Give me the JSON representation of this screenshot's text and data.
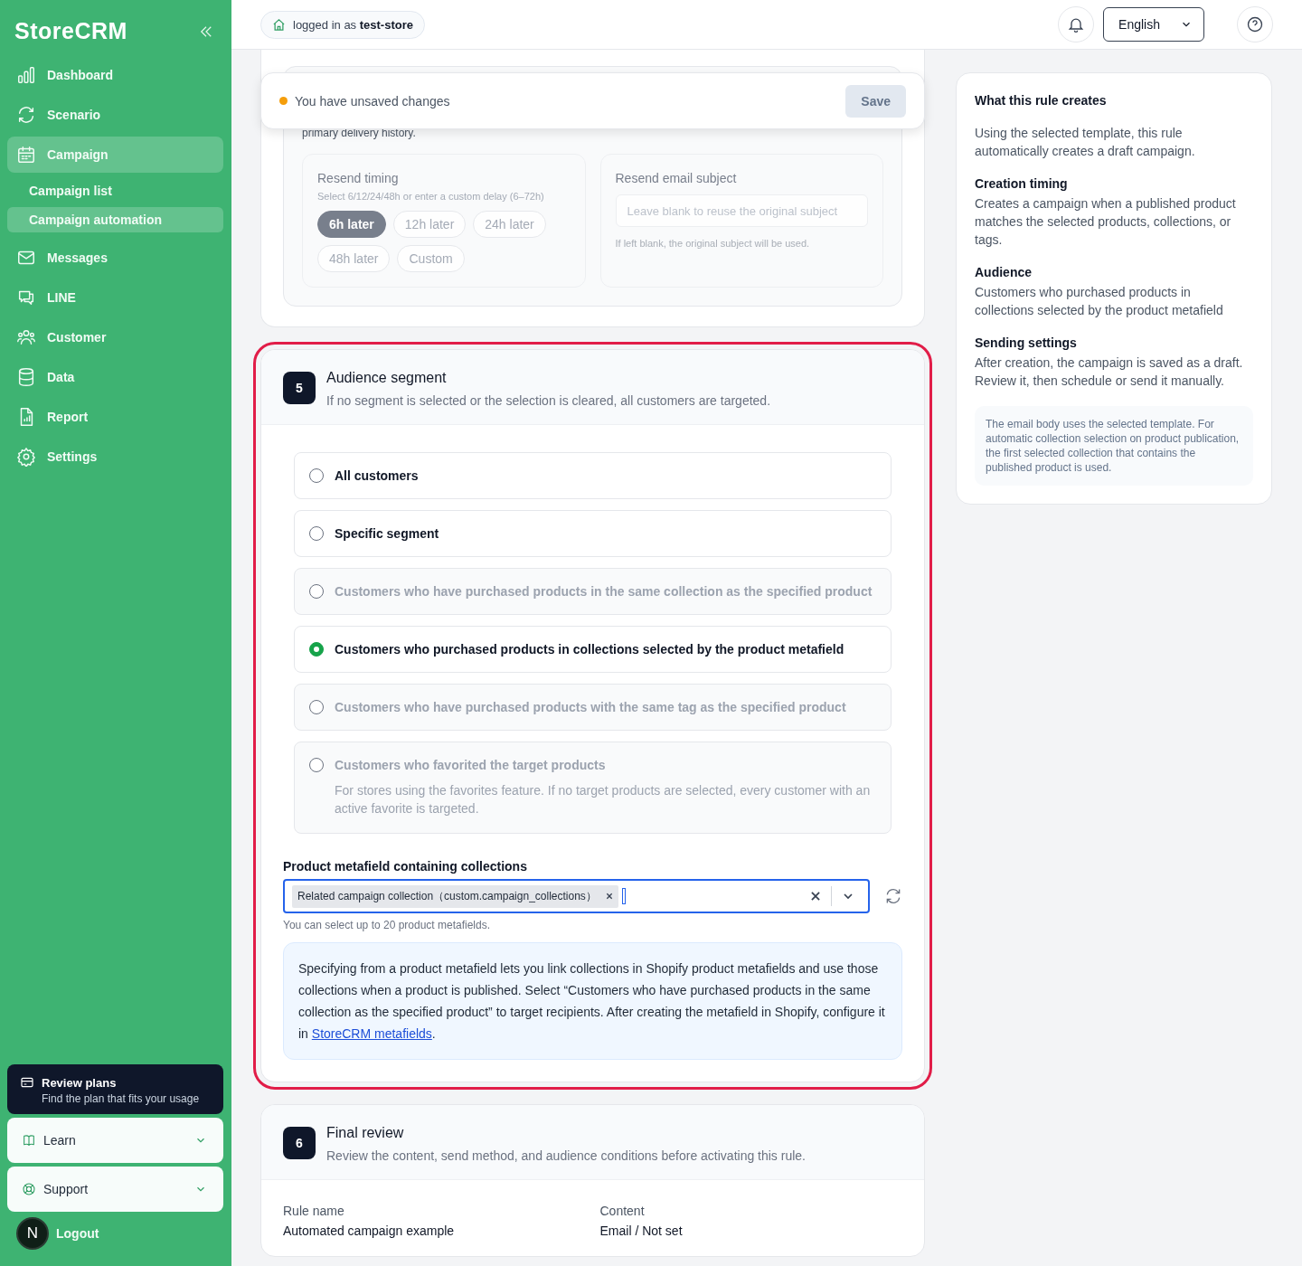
{
  "sidebar": {
    "brand": "StoreCRM",
    "items": [
      {
        "label": "Dashboard",
        "selected": false
      },
      {
        "label": "Scenario",
        "selected": false
      },
      {
        "label": "Campaign",
        "selected": true,
        "children": [
          {
            "label": "Campaign list",
            "selected": false
          },
          {
            "label": "Campaign automation",
            "selected": true
          }
        ]
      },
      {
        "label": "Messages",
        "selected": false
      },
      {
        "label": "LINE",
        "selected": false
      },
      {
        "label": "Customer",
        "selected": false
      },
      {
        "label": "Data",
        "selected": false
      },
      {
        "label": "Report",
        "selected": false
      },
      {
        "label": "Settings",
        "selected": false
      }
    ],
    "plans": {
      "title": "Review plans",
      "subtitle": "Find the plan that fits your usage"
    },
    "expanders": [
      {
        "label": "Learn",
        "expanded": false
      },
      {
        "label": "Support",
        "expanded": false
      }
    ],
    "logout": "Logout",
    "avatar": "N"
  },
  "topbar": {
    "login": "logged in as **test-store**",
    "language": "English"
  },
  "unsaved": {
    "message": "You have unsaved changes",
    "save": "Save"
  },
  "previous_section": {
    "text_tail": "primary delivery history.",
    "resend_timing": {
      "label": "Resend timing",
      "hint": "Select 6/12/24/48h or enter a custom delay (6–72h)",
      "options": [
        {
          "label": "6h later",
          "selected": true
        },
        {
          "label": "12h later",
          "selected": false
        },
        {
          "label": "24h later",
          "selected": false
        },
        {
          "label": "48h later",
          "selected": false
        },
        {
          "label": "Custom",
          "selected": false
        }
      ]
    },
    "resend_subject": {
      "label": "Resend email subject",
      "placeholder": "Leave blank to reuse the original subject",
      "help": "If left blank, the original subject will be used."
    }
  },
  "audience": {
    "step": "5",
    "title": "Audience segment",
    "description": "If no segment is selected or the selection is cleared, all customers are targeted.",
    "highlighted": true,
    "options": [
      {
        "label": "All customers",
        "selected": false,
        "disabled": false
      },
      {
        "label": "Specific segment",
        "selected": false,
        "disabled": false
      },
      {
        "label": "Customers who have purchased products in the same collection as the specified product",
        "selected": false,
        "disabled": true
      },
      {
        "label": "Customers who purchased products in collections selected by the product metafield",
        "selected": true,
        "disabled": false
      },
      {
        "label": "Customers who have purchased products with the same tag as the specified product",
        "selected": false,
        "disabled": true
      },
      {
        "label": "Customers who favorited the target products",
        "description": "For stores using the favorites feature. If no target products are selected, every customer with an active favorite is targeted.",
        "selected": false,
        "disabled": true
      }
    ],
    "metafield": {
      "label": "Product metafield containing collections",
      "tags": [
        "Related campaign collection（custom.campaign_collections）"
      ],
      "help": "You can select up to 20 product metafields."
    },
    "info": {
      "text": "Specifying from a product metafield lets you link collections in Shopify product metafields and use those collections when a product is published. Select “Customers who have purchased products in the same collection as the specified product” to target recipients. After creating the metafield in Shopify, configure it in ",
      "link": "StoreCRM metafields",
      "end": "."
    }
  },
  "review": {
    "step": "6",
    "title": "Final review",
    "description": "Review the content, send method, and audience conditions before activating this rule.",
    "fields": [
      {
        "label": "Rule name",
        "value": "Automated campaign example"
      },
      {
        "label": "Content",
        "value": "Email / Not set"
      }
    ]
  },
  "summary": {
    "title": "What this rule creates",
    "intro": "Using the selected template, this rule automatically creates a draft campaign.",
    "items": [
      {
        "heading": "Creation timing",
        "text": "Creates a campaign when a published product matches the selected products, collections, or tags."
      },
      {
        "heading": "Audience",
        "text": "Customers who purchased products in collections selected by the product metafield"
      },
      {
        "heading": "Sending settings",
        "text": "After creation, the campaign is saved as a draft. Review it, then schedule or send it manually."
      }
    ],
    "note": "The email body uses the selected template. For automatic collection selection on product publication, the first selected collection that contains the published product is used."
  }
}
